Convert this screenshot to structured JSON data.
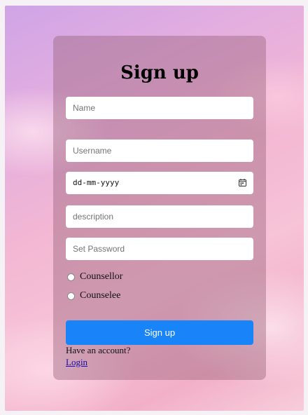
{
  "form": {
    "title": "Sign up",
    "name_placeholder": "Name",
    "username_placeholder": "Username",
    "date_placeholder": "dd-mm-yyyy",
    "description_placeholder": "description",
    "password_placeholder": "Set Password",
    "role_options": [
      "Counsellor",
      "Counselee"
    ],
    "submit_label": "Sign up",
    "have_account_text": "Have an account?",
    "login_link_label": "Login"
  },
  "colors": {
    "button": "#1984f7",
    "link": "#1a0dab"
  },
  "icons": {
    "date": "calendar-icon"
  }
}
